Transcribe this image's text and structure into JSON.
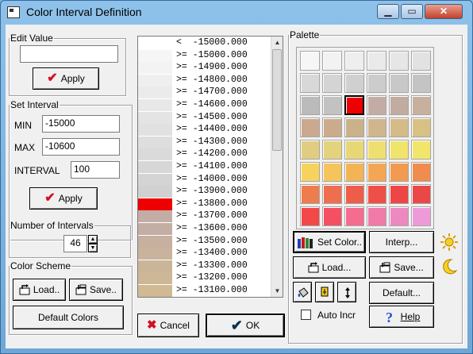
{
  "window": {
    "title": "Color Interval Definition",
    "buttons": {
      "minimize": "▁",
      "maximize": "▭",
      "close": "✕"
    }
  },
  "edit_value": {
    "label": "Edit Value",
    "value": "",
    "apply": "Apply"
  },
  "set_interval": {
    "label": "Set Interval",
    "min_label": "MIN",
    "min_value": "-15000",
    "max_label": "MAX",
    "max_value": "-10600",
    "interval_label": "INTERVAL",
    "interval_value": "100",
    "apply": "Apply"
  },
  "num_intervals": {
    "label": "Number of Intervals",
    "value": "46"
  },
  "color_scheme": {
    "label": "Color Scheme",
    "load": "Load..",
    "save": "Save..",
    "default": "Default Colors"
  },
  "interval_list": {
    "items": [
      {
        "text": "<  -15000.000",
        "color": "#ffffff"
      },
      {
        "text": ">= -15000.000",
        "color": "#f6f6f6"
      },
      {
        "text": ">= -14900.000",
        "color": "#f3f3f3"
      },
      {
        "text": ">= -14800.000",
        "color": "#efefef"
      },
      {
        "text": ">= -14700.000",
        "color": "#ebebeb"
      },
      {
        "text": ">= -14600.000",
        "color": "#e8e8e8"
      },
      {
        "text": ">= -14500.000",
        "color": "#e4e4e4"
      },
      {
        "text": ">= -14400.000",
        "color": "#e1e1e1"
      },
      {
        "text": ">= -14300.000",
        "color": "#dedede"
      },
      {
        "text": ">= -14200.000",
        "color": "#dadada"
      },
      {
        "text": ">= -14100.000",
        "color": "#d7d7d7"
      },
      {
        "text": ">= -14000.000",
        "color": "#d4d4d4"
      },
      {
        "text": ">= -13900.000",
        "color": "#d1d1d1"
      },
      {
        "text": ">= -13800.000",
        "color": "#ee0000"
      },
      {
        "text": ">= -13700.000",
        "color": "#c3ada6"
      },
      {
        "text": ">= -13600.000",
        "color": "#c4aea3"
      },
      {
        "text": ">= -13500.000",
        "color": "#c6b09f"
      },
      {
        "text": ">= -13400.000",
        "color": "#c9b39c"
      },
      {
        "text": ">= -13300.000",
        "color": "#cbb599"
      },
      {
        "text": ">= -13200.000",
        "color": "#cdb796"
      },
      {
        "text": ">= -13100.000",
        "color": "#d0b993"
      }
    ]
  },
  "palette": {
    "label": "Palette",
    "rows": [
      [
        "#f6f6f6",
        "#f2f2f2",
        "#eeeeee",
        "#eaeaea",
        "#e6e6e6",
        "#e2e2e2"
      ],
      [
        "#d8d8d8",
        "#d4d4d4",
        "#d0d0d0",
        "#cccccc",
        "#c8c8c8",
        "#c4c4c4"
      ],
      [
        "#bbbbbb",
        "#c2c2c2",
        "#ee0000",
        "#c4aca6",
        "#c2ab9f",
        "#c8b09e"
      ],
      [
        "#cba98e",
        "#cbab8c",
        "#c9b28a",
        "#cfb68c",
        "#d4bb87",
        "#d8c184"
      ],
      [
        "#e0cd80",
        "#e5d27c",
        "#e8d776",
        "#ede070",
        "#f0e46a",
        "#f2e66a"
      ],
      [
        "#f7d35e",
        "#f5c45a",
        "#f2b455",
        "#f3a754",
        "#f19a50",
        "#ef8c4e"
      ],
      [
        "#ef7c4c",
        "#ee6e4d",
        "#ee5c4a",
        "#ee5048",
        "#ec4744",
        "#ea4747"
      ],
      [
        "#f24848",
        "#f45062",
        "#f46c8e",
        "#f07aa8",
        "#ee88c0",
        "#ee9ad8"
      ]
    ]
  },
  "actions": {
    "set_color": "Set Color..",
    "interp": "Interp...",
    "load": "Load...",
    "save": "Save...",
    "default": "Default...",
    "auto_incr": "Auto Incr",
    "auto_incr_checked": false,
    "help": "Help"
  },
  "footer": {
    "cancel": "Cancel",
    "ok": "OK"
  }
}
